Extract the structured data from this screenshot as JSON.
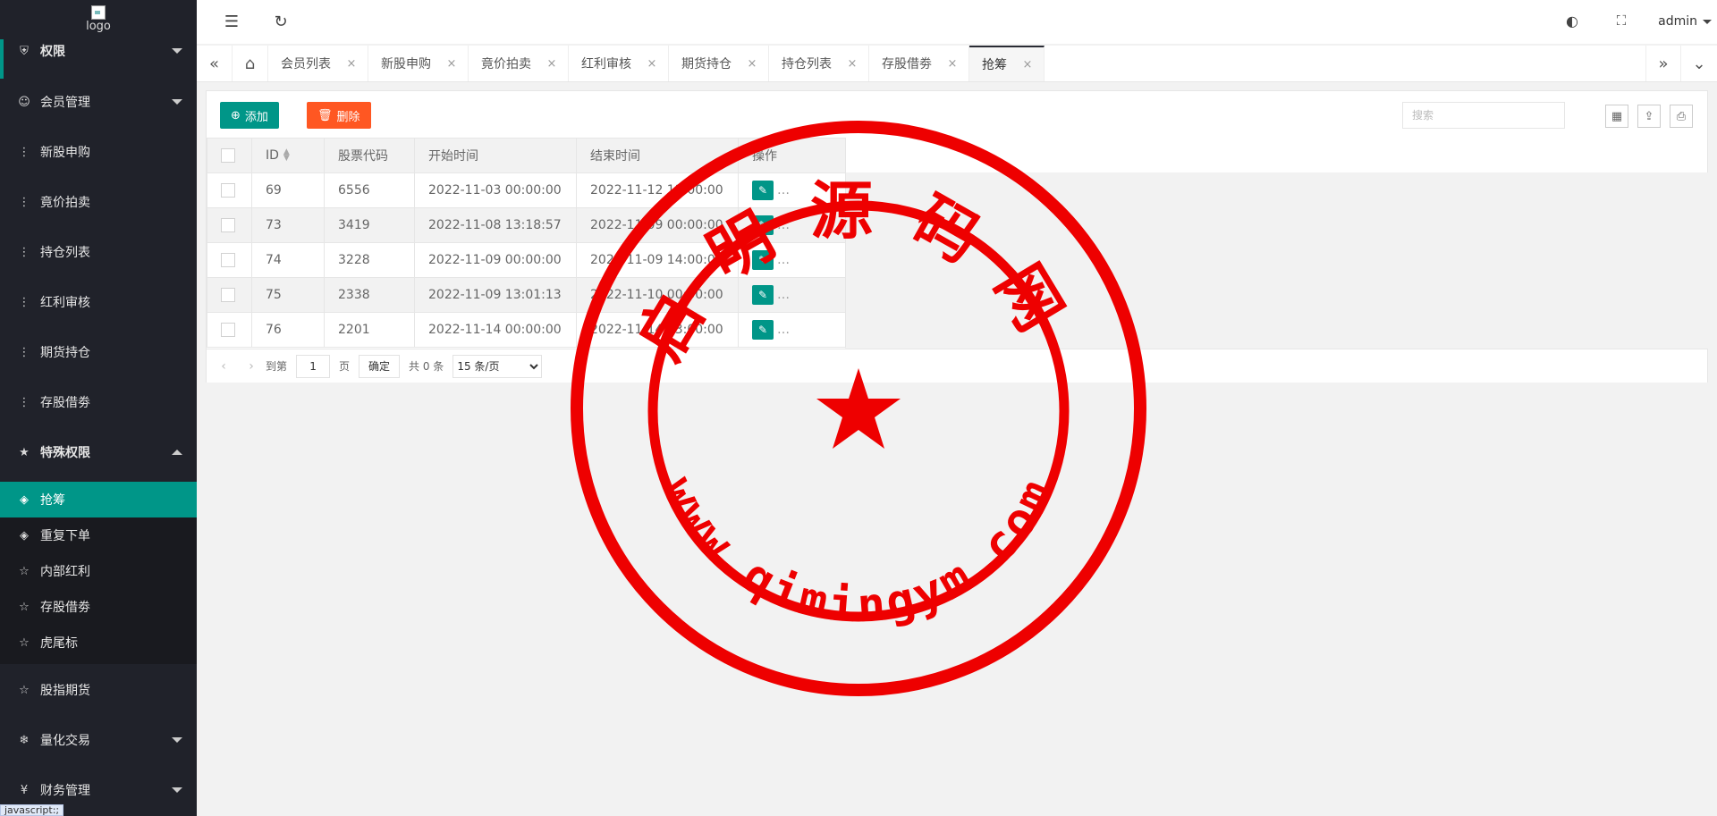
{
  "sidebar": {
    "logo_alt": "logo",
    "items": [
      {
        "label": "权限",
        "icon": "shield-icon",
        "glyph": "⛨",
        "expanded": false
      },
      {
        "label": "会员管理",
        "icon": "user-icon",
        "glyph": "☺",
        "expanded": false
      },
      {
        "label": "新股申购",
        "icon": "dots-icon",
        "glyph": "⋮"
      },
      {
        "label": "竟价拍卖",
        "icon": "dots-icon",
        "glyph": "⋮"
      },
      {
        "label": "持仓列表",
        "icon": "dots-icon",
        "glyph": "⋮"
      },
      {
        "label": "红利审核",
        "icon": "dots-icon",
        "glyph": "⋮"
      },
      {
        "label": "期货持仓",
        "icon": "dots-icon",
        "glyph": "⋮"
      },
      {
        "label": "存股借劵",
        "icon": "dots-icon",
        "glyph": "⋮"
      },
      {
        "label": "特殊权限",
        "icon": "star-icon",
        "glyph": "★",
        "expanded": true
      },
      {
        "label": "抢筹",
        "icon": "diamond-icon",
        "glyph": "◈",
        "active": true
      },
      {
        "label": "重复下单",
        "icon": "diamond-icon",
        "glyph": "◈"
      },
      {
        "label": "内部红利",
        "icon": "star-outline-icon",
        "glyph": "☆"
      },
      {
        "label": "存股借劵",
        "icon": "star-outline-icon",
        "glyph": "☆"
      },
      {
        "label": "虎尾标",
        "icon": "star-outline-icon",
        "glyph": "☆"
      },
      {
        "label": "股指期货",
        "icon": "star-outline-icon",
        "glyph": "☆"
      },
      {
        "label": "量化交易",
        "icon": "snowflake-icon",
        "glyph": "❄",
        "expanded": false
      },
      {
        "label": "财务管理",
        "icon": "yen-icon",
        "glyph": "¥",
        "expanded": false
      }
    ],
    "status_text": "javascript:;"
  },
  "header": {
    "menu_icon": "☰",
    "refresh_icon": "↻",
    "theme_icon": "◐",
    "fullscreen_icon": "⛶",
    "user": "admin"
  },
  "tabs": {
    "prev": "«",
    "home": "⌂",
    "next": "»",
    "more": "⌄",
    "close": "×",
    "items": [
      "会员列表",
      "新股申购",
      "竟价拍卖",
      "红利审核",
      "期货持仓",
      "持仓列表",
      "存股借劵",
      "抢筹"
    ],
    "active_index": 7
  },
  "toolbar": {
    "add_label": "添加",
    "add_icon": "⊕",
    "delete_label": "删除",
    "delete_icon": "🗑",
    "search_placeholder": "搜索",
    "columns_icon": "▦",
    "export_icon": "⇪",
    "print_icon": "⎙"
  },
  "table": {
    "columns": [
      "ID",
      "股票代码",
      "开始时间",
      "结束时间",
      "操作"
    ],
    "rows": [
      {
        "id": "69",
        "code": "6556",
        "start": "2022-11-03 00:00:00",
        "end": "2022-11-12 13:00:00"
      },
      {
        "id": "73",
        "code": "3419",
        "start": "2022-11-08 13:18:57",
        "end": "2022-11-09 00:00:00"
      },
      {
        "id": "74",
        "code": "3228",
        "start": "2022-11-09 00:00:00",
        "end": "2022-11-09 14:00:00"
      },
      {
        "id": "75",
        "code": "2338",
        "start": "2022-11-09 13:01:13",
        "end": "2022-11-10 00:00:00"
      },
      {
        "id": "76",
        "code": "2201",
        "start": "2022-11-14 00:00:00",
        "end": "2022-11-14 13:00:00"
      }
    ],
    "edit_icon": "✎",
    "more_text": "…"
  },
  "pager": {
    "prev": "‹",
    "next": "›",
    "goto_label": "到第",
    "page_value": "1",
    "page_suffix": "页",
    "confirm": "确定",
    "total": "共 0 条",
    "page_size": "15 条/页"
  },
  "stamp": {
    "color": "#ee0000",
    "top_text": "启明源码网",
    "bottom_text": "www.qimingym.com"
  }
}
